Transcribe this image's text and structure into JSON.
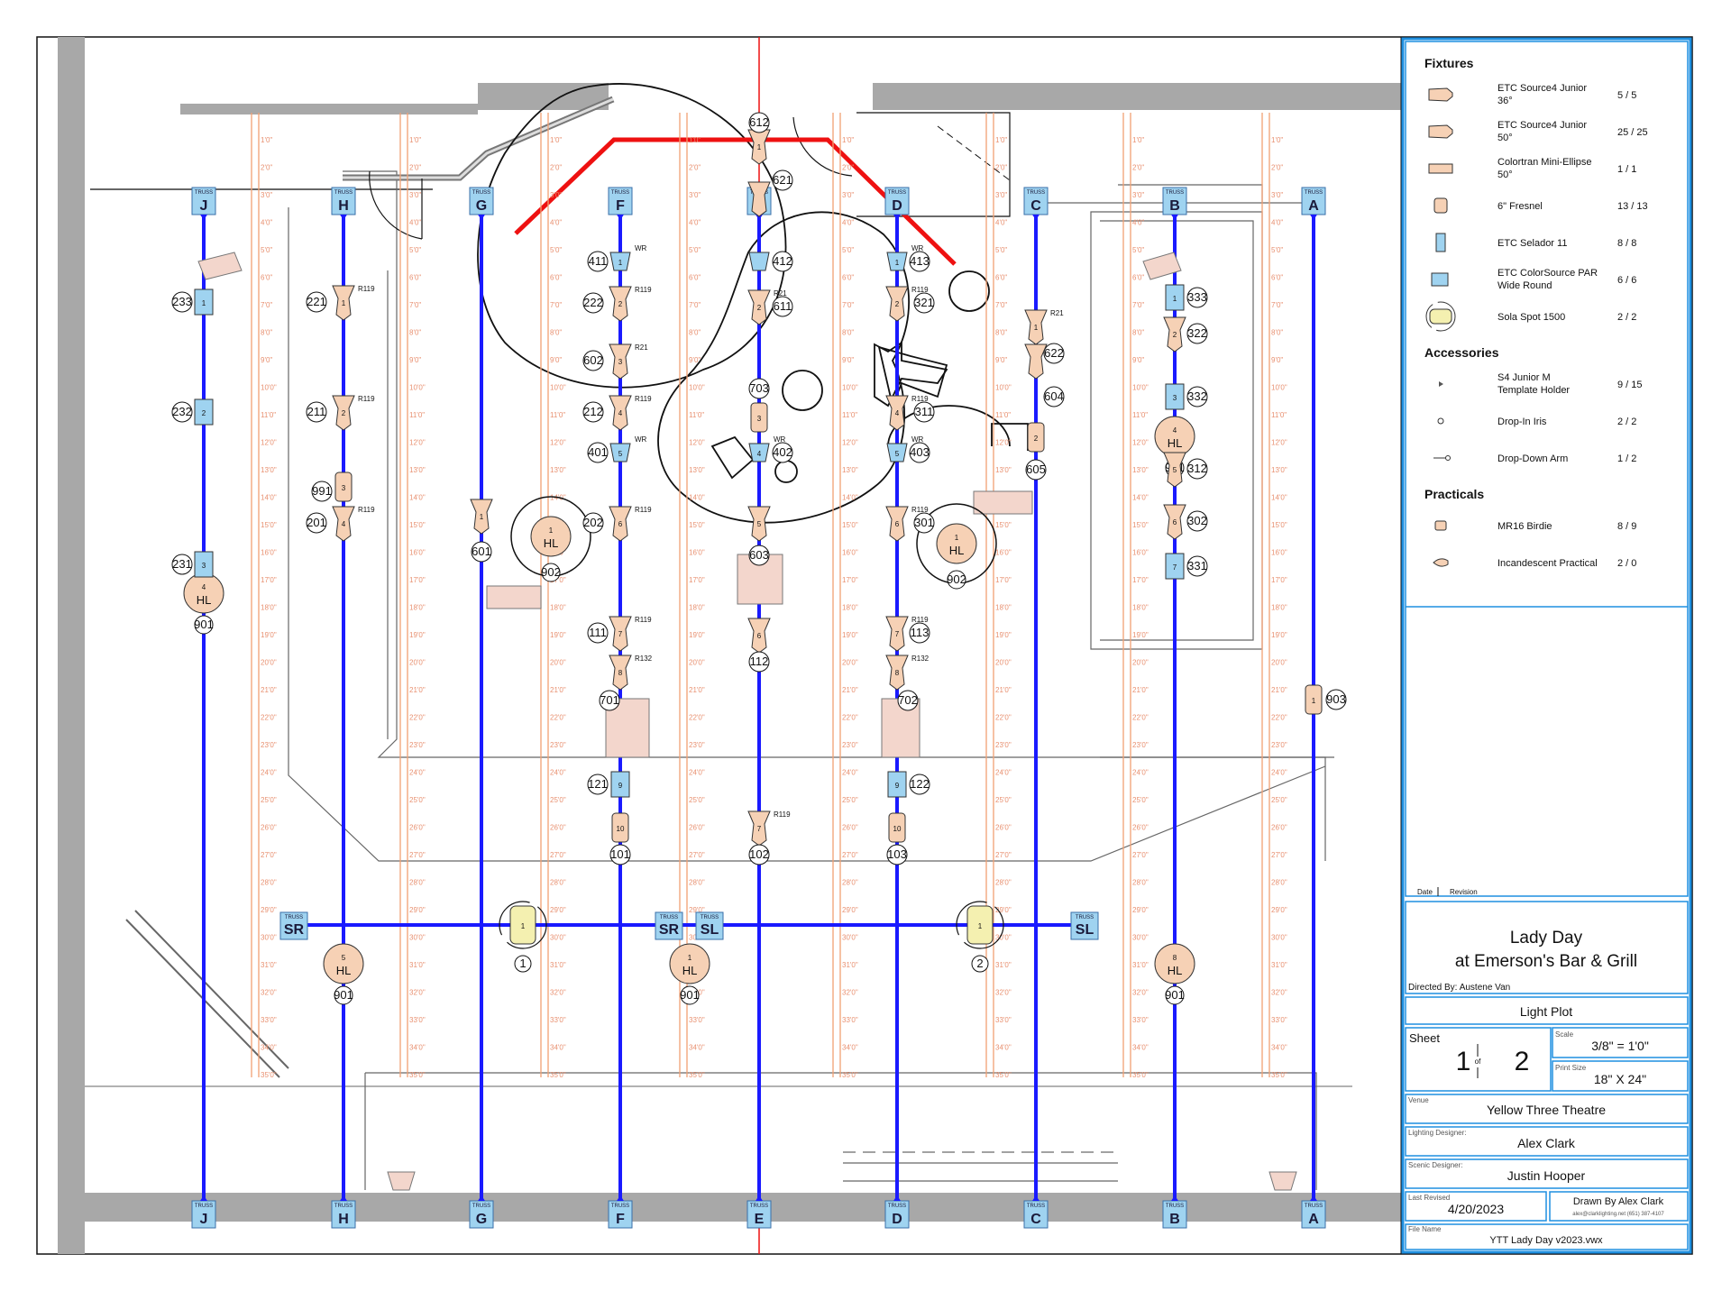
{
  "legend": {
    "sections": [
      {
        "title": "Fixtures",
        "y": 0,
        "items": [
          {
            "icon": "source4-junior-36-icon",
            "name": [
              "ETC Source4 Junior",
              "36°"
            ],
            "count": "5 / 5"
          },
          {
            "icon": "source4-junior-50-icon",
            "name": [
              "ETC Source4 Junior",
              "50°"
            ],
            "count": "25 / 25"
          },
          {
            "icon": "mini-ellipse-icon",
            "name": [
              "Colortran Mini-Ellipse",
              "50°"
            ],
            "count": "1 / 1"
          },
          {
            "icon": "fresnel-icon",
            "name": [
              "6\" Fresnel"
            ],
            "count": "13 / 13"
          },
          {
            "icon": "selador-icon",
            "name": [
              "ETC Selador 11"
            ],
            "count": "8 / 8"
          },
          {
            "icon": "colorsource-par-icon",
            "name": [
              "ETC ColorSource PAR",
              "Wide Round"
            ],
            "count": "6 / 6"
          },
          {
            "icon": "sola-spot-icon",
            "name": [
              "Sola Spot 1500"
            ],
            "count": "2 / 2"
          }
        ]
      },
      {
        "title": "Accessories",
        "items": [
          {
            "icon": "template-holder-icon",
            "name": [
              "S4 Junior M",
              "Template Holder"
            ],
            "count": "9 / 15"
          },
          {
            "icon": "drop-in-iris-icon",
            "name": [
              "Drop-In Iris"
            ],
            "count": "2 / 2"
          },
          {
            "icon": "drop-down-arm-icon",
            "name": [
              "Drop-Down Arm"
            ],
            "count": "1 / 2"
          }
        ]
      },
      {
        "title": "Practicals",
        "items": [
          {
            "icon": "mr16-birdie-icon",
            "name": [
              "MR16 Birdie"
            ],
            "count": "8 / 9"
          },
          {
            "icon": "incandescent-practical-icon",
            "name": [
              "Incandescent Practical"
            ],
            "count": "2 / 0"
          }
        ]
      }
    ]
  },
  "revision": {
    "date_label": "Date",
    "revision_label": "Revision"
  },
  "title_block": {
    "show_title": [
      "Lady Day",
      "at Emerson's Bar & Grill"
    ],
    "directed_by": "Directed By: Austene Van",
    "drawing_title": "Light Plot",
    "sheet_label": "Sheet",
    "sheet_number": "1",
    "sheet_of": "of",
    "sheet_total": "2",
    "scale_label": "Scale",
    "scale": "3/8\" = 1'0\"",
    "print_size_label": "Print Size",
    "print_size": "18\" X 24\"",
    "venue_label": "Venue",
    "venue": "Yellow Three Theatre",
    "ld_label": "Lighting Designer:",
    "ld": "Alex Clark",
    "sd_label": "Scenic Designer:",
    "sd": "Justin Hooper",
    "last_revised_label": "Last Revised",
    "last_revised": "4/20/2023",
    "drawn_by": "Drawn By Alex Clark",
    "drawn_contact": "alex@clarklighting.net (651) 387-4107",
    "file_name_label": "File Name",
    "file_name": "YTT Lady Day v2023.vwx"
  },
  "plot": {
    "truss_word": "TRUSS",
    "pipes": [
      "J",
      "H",
      "G",
      "F",
      "E",
      "D",
      "C",
      "B",
      "A"
    ],
    "cross_truss_labels": [
      "SR",
      "SR",
      "SL",
      "SL"
    ],
    "distance_marks": [
      "1'0\"",
      "2'0\"",
      "3'0\"",
      "4'0\"",
      "5'0\"",
      "6'0\"",
      "7'0\"",
      "8'0\"",
      "9'0\"",
      "10'0\"",
      "11'0\"",
      "12'0\"",
      "13'0\"",
      "14'0\"",
      "15'0\"",
      "16'0\"",
      "17'0\"",
      "18'0\"",
      "19'0\"",
      "20'0\"",
      "21'0\"",
      "22'0\"",
      "23'0\"",
      "24'0\"",
      "25'0\"",
      "26'0\"",
      "27'0\"",
      "28'0\"",
      "29'0\"",
      "30'0\"",
      "31'0\"",
      "32'0\"",
      "33'0\"",
      "34'0\"",
      "35'0\""
    ],
    "hl_label": "HL",
    "house_lights": [
      {
        "pipe": "J",
        "unit": "4",
        "circuit": "901"
      },
      {
        "pipe": "G",
        "unit": "1",
        "circuit": "902"
      },
      {
        "pipe": "D",
        "unit": "1",
        "circuit": "902"
      },
      {
        "pipe": "B",
        "unit": "4",
        "circuit": "901"
      },
      {
        "pipe": "H",
        "unit": "5",
        "circuit": "901"
      },
      {
        "pipe": "F",
        "unit": "1",
        "circuit": "901"
      },
      {
        "pipe": "B",
        "unit": "8",
        "circuit": "901"
      }
    ],
    "sola_spots": [
      {
        "unit": "1",
        "label": "1"
      },
      {
        "unit": "1",
        "label": "2"
      }
    ],
    "units": [
      {
        "pipe": "J",
        "unit": "1",
        "circuit": "233",
        "type": "selador"
      },
      {
        "pipe": "J",
        "unit": "2",
        "circuit": "232",
        "type": "selador"
      },
      {
        "pipe": "J",
        "unit": "3",
        "circuit": "231",
        "type": "selador"
      },
      {
        "pipe": "H",
        "unit": "1",
        "circuit": "221",
        "type": "s4",
        "color": "R119"
      },
      {
        "pipe": "H",
        "unit": "2",
        "circuit": "211",
        "type": "s4",
        "color": "R119"
      },
      {
        "pipe": "H",
        "unit": "3",
        "circuit": "991",
        "type": "fresnel"
      },
      {
        "pipe": "H",
        "unit": "4",
        "circuit": "201",
        "type": "s4",
        "color": "R119"
      },
      {
        "pipe": "G",
        "unit": "1",
        "circuit": "601",
        "type": "s4"
      },
      {
        "pipe": "F",
        "unit": "1",
        "circuit": "411",
        "type": "par",
        "color": "WR"
      },
      {
        "pipe": "F",
        "unit": "2",
        "circuit": "222",
        "type": "s4",
        "color": "R119"
      },
      {
        "pipe": "F",
        "unit": "3",
        "circuit": "602",
        "type": "s4",
        "color": "R21"
      },
      {
        "pipe": "F",
        "unit": "4",
        "circuit": "212",
        "type": "s4",
        "color": "R119"
      },
      {
        "pipe": "F",
        "unit": "5",
        "circuit": "401",
        "type": "par",
        "color": "WR"
      },
      {
        "pipe": "F",
        "unit": "6",
        "circuit": "202",
        "type": "s4",
        "color": "R119"
      },
      {
        "pipe": "F",
        "unit": "7",
        "circuit": "111",
        "type": "s4",
        "color": "R119"
      },
      {
        "pipe": "F",
        "unit": "8",
        "circuit": "701",
        "type": "s4",
        "color": "R132"
      },
      {
        "pipe": "F",
        "unit": "9",
        "circuit": "121",
        "type": "selador"
      },
      {
        "pipe": "F",
        "unit": "10",
        "circuit": "101",
        "type": "fresnel"
      },
      {
        "pipe": "E",
        "unit": "1",
        "circuit": "612",
        "type": "s4"
      },
      {
        "pipe": "E",
        "unit": "",
        "circuit": "621",
        "type": "s4"
      },
      {
        "pipe": "E",
        "unit": "",
        "circuit": "412",
        "type": "par"
      },
      {
        "pipe": "E",
        "unit": "2",
        "circuit": "611",
        "type": "s4",
        "color": "R21"
      },
      {
        "pipe": "E",
        "unit": "3",
        "circuit": "703",
        "type": "fresnel"
      },
      {
        "pipe": "E",
        "unit": "4",
        "circuit": "402",
        "type": "par",
        "color": "WR"
      },
      {
        "pipe": "E",
        "unit": "5",
        "circuit": "603",
        "type": "s4"
      },
      {
        "pipe": "E",
        "unit": "6",
        "circuit": "112",
        "type": "s4"
      },
      {
        "pipe": "E",
        "unit": "7",
        "circuit": "102",
        "type": "s4",
        "color": "R119"
      },
      {
        "pipe": "D",
        "unit": "1",
        "circuit": "413",
        "type": "par",
        "color": "WR"
      },
      {
        "pipe": "D",
        "unit": "2",
        "circuit": "321",
        "type": "s4",
        "color": "R119"
      },
      {
        "pipe": "D",
        "unit": "4",
        "circuit": "311",
        "type": "s4",
        "color": "R119"
      },
      {
        "pipe": "D",
        "unit": "5",
        "circuit": "403",
        "type": "par",
        "color": "WR"
      },
      {
        "pipe": "D",
        "unit": "6",
        "circuit": "301",
        "type": "s4",
        "color": "R119"
      },
      {
        "pipe": "D",
        "unit": "7",
        "circuit": "113",
        "type": "s4",
        "color": "R119"
      },
      {
        "pipe": "D",
        "unit": "8",
        "circuit": "702",
        "type": "s4",
        "color": "R132"
      },
      {
        "pipe": "D",
        "unit": "9",
        "circuit": "122",
        "type": "selador"
      },
      {
        "pipe": "D",
        "unit": "10",
        "circuit": "103",
        "type": "fresnel"
      },
      {
        "pipe": "C",
        "unit": "1",
        "circuit": "622",
        "type": "s4",
        "color": "R21"
      },
      {
        "pipe": "C",
        "unit": "",
        "circuit": "604",
        "type": "s4"
      },
      {
        "pipe": "C",
        "unit": "2",
        "circuit": "605",
        "type": "fresnel"
      },
      {
        "pipe": "B",
        "unit": "1",
        "circuit": "333",
        "type": "selador"
      },
      {
        "pipe": "B",
        "unit": "2",
        "circuit": "322",
        "type": "s4"
      },
      {
        "pipe": "B",
        "unit": "3",
        "circuit": "332",
        "type": "selador"
      },
      {
        "pipe": "B",
        "unit": "5",
        "circuit": "312",
        "type": "s4"
      },
      {
        "pipe": "B",
        "unit": "6",
        "circuit": "302",
        "type": "s4"
      },
      {
        "pipe": "B",
        "unit": "7",
        "circuit": "331",
        "type": "selador"
      },
      {
        "pipe": "A",
        "unit": "1",
        "circuit": "903",
        "type": "fresnel"
      }
    ]
  },
  "colors": {
    "pipe": "#1a1aff",
    "truss_box": "#9fd3f0",
    "fixture": "#f6d1b5",
    "distance": "#f2a074",
    "red_line": "#e11",
    "title_border": "#1e8fe0",
    "wall": "#a8a8a8"
  }
}
